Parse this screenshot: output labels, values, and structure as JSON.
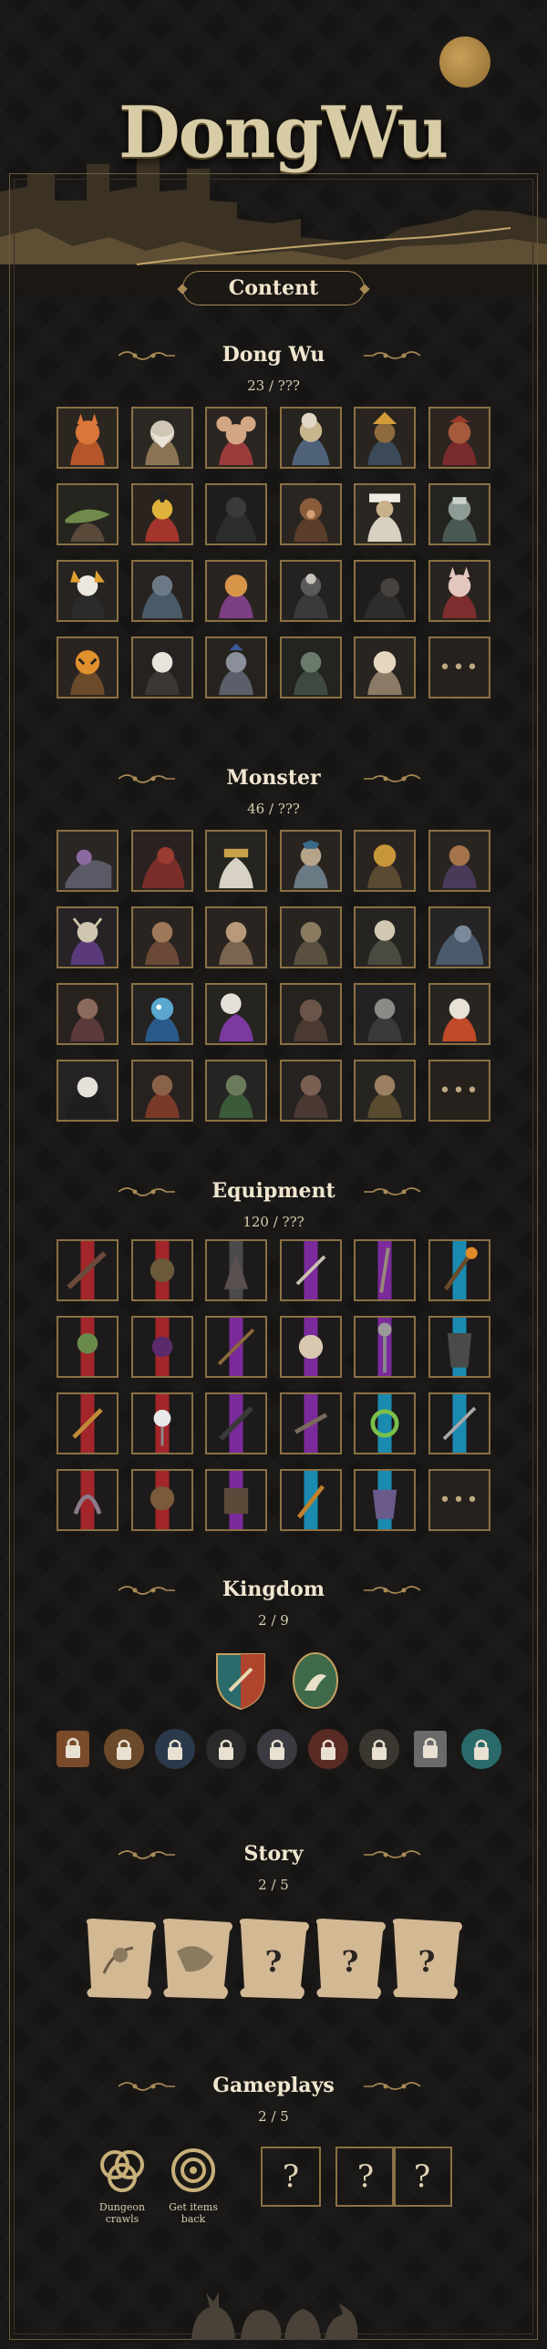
{
  "logo": {
    "text": "DongWu"
  },
  "content_badge": "Content",
  "sections": {
    "dongwu": {
      "title": "Dong Wu",
      "count": "23 / ???",
      "more": "•••"
    },
    "monster": {
      "title": "Monster",
      "count": "46 / ???",
      "more": "•••"
    },
    "equipment": {
      "title": "Equipment",
      "count": "120 / ???",
      "more": "•••"
    },
    "kingdom": {
      "title": "Kingdom",
      "count": "2 / 9"
    },
    "story": {
      "title": "Story",
      "count": "2 / 5"
    },
    "gameplays": {
      "title": "Gameplays",
      "count": "2 / 5",
      "items": [
        "Dungeon crawls",
        "Get items back"
      ],
      "unknown": "?"
    }
  },
  "colors": {
    "background": "#171513",
    "gold": "#a88a55",
    "tile_border": "#8a7145",
    "parchment": "#d2b893"
  },
  "icons": [
    "flourish-icon",
    "shield-icon",
    "lock-seal-icon",
    "scroll-icon",
    "ring-icon",
    "target-icon"
  ]
}
